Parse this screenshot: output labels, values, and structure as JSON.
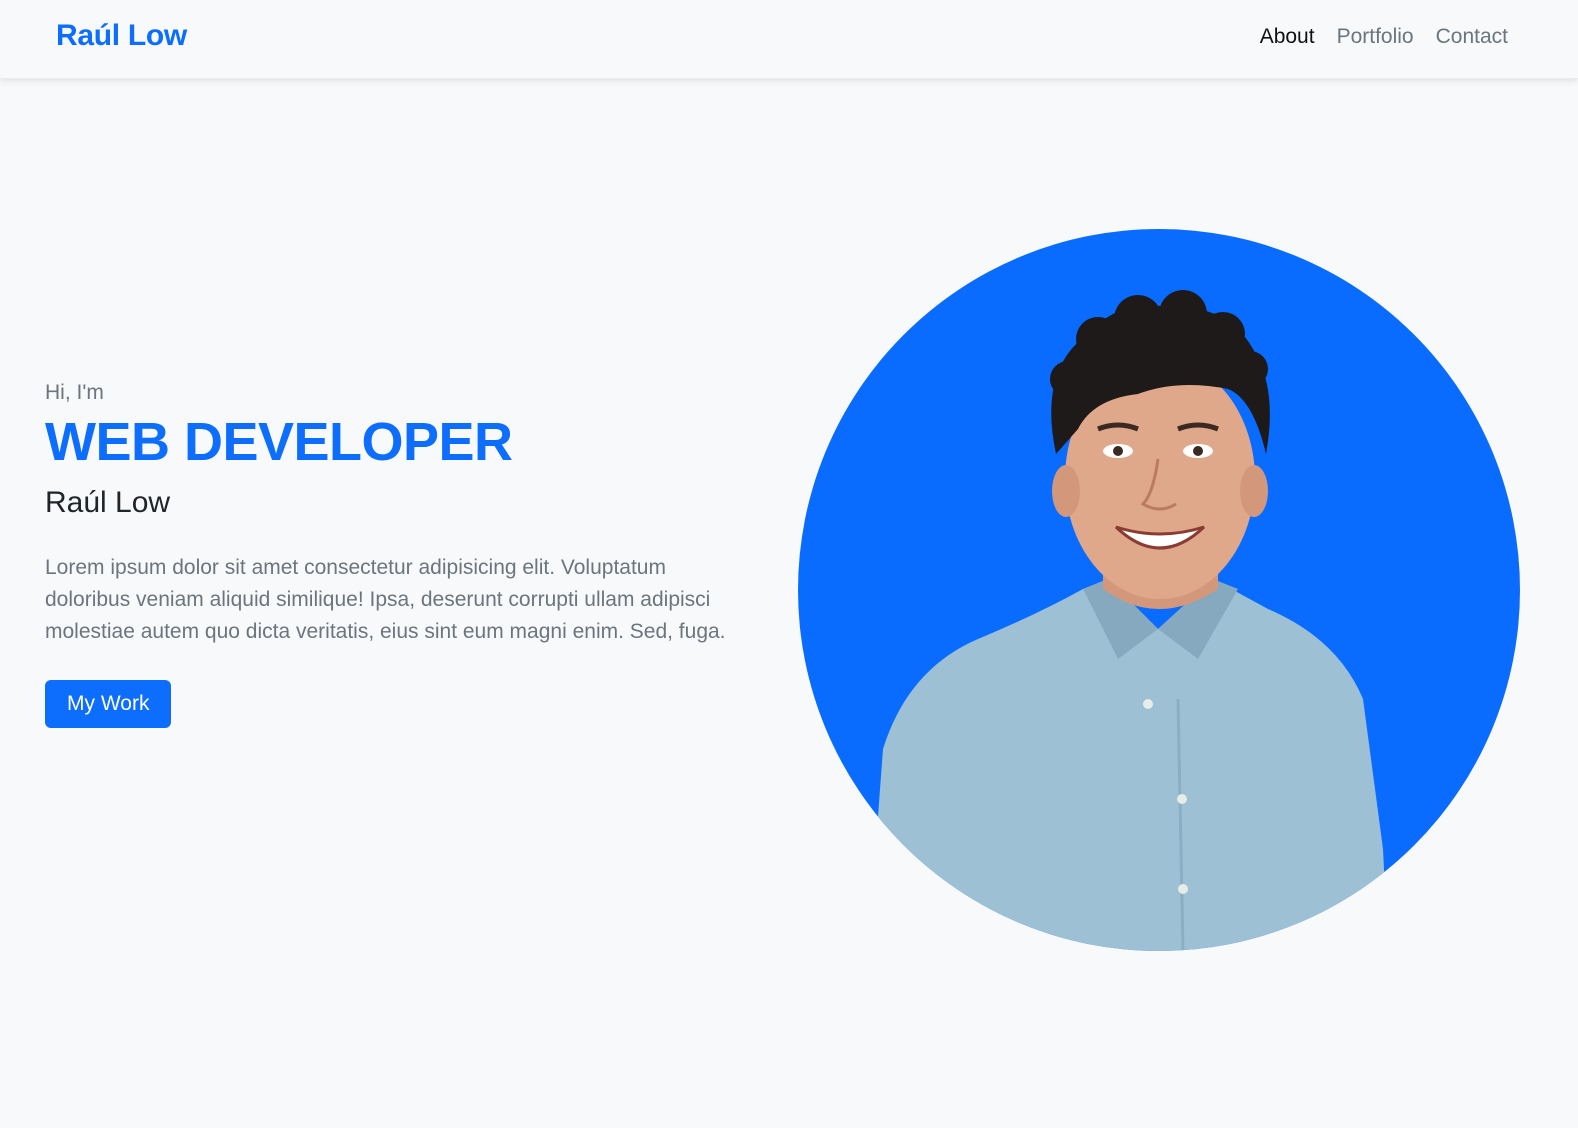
{
  "navbar": {
    "brand": "Raúl Low",
    "links": [
      {
        "label": "About",
        "active": true
      },
      {
        "label": "Portfolio",
        "active": false
      },
      {
        "label": "Contact",
        "active": false
      }
    ]
  },
  "hero": {
    "greeting": "Hi, I'm",
    "headline": "WEB DEVELOPER",
    "name": "Raúl Low",
    "description": "Lorem ipsum dolor sit amet consectetur adipisicing elit. Voluptatum doloribus veniam aliquid similique! Ipsa, deserunt corrupti ullam adipisci molestiae autem quo dicta veritatis, eius sint eum magni enim. Sed, fuga.",
    "cta_label": "My Work"
  },
  "colors": {
    "accent": "#0d6efd",
    "background": "#f8f9fa",
    "muted_text": "#6c757d"
  }
}
